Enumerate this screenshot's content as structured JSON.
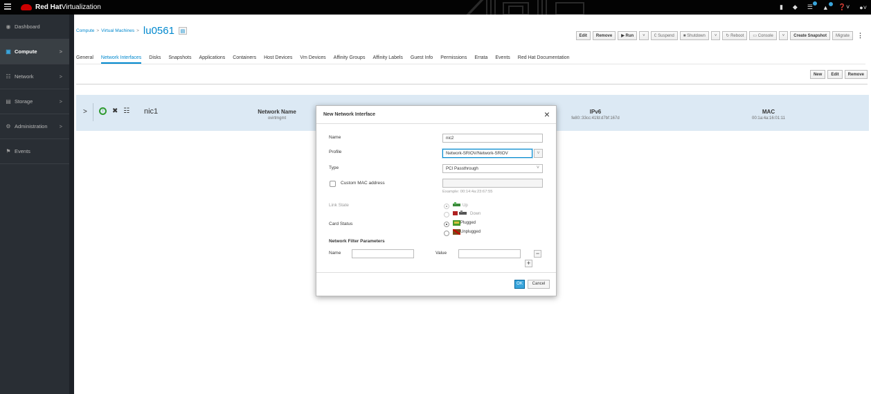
{
  "header": {
    "brand_red": "Red Hat",
    "brand_product": "Virtualization"
  },
  "sidebar": {
    "items": [
      {
        "label": "Dashboard",
        "icon": "dashboard-icon",
        "active": false
      },
      {
        "label": "Compute",
        "icon": "compute-icon",
        "active": true
      },
      {
        "label": "Network",
        "icon": "network-icon",
        "active": false
      },
      {
        "label": "Storage",
        "icon": "storage-icon",
        "active": false
      },
      {
        "label": "Administration",
        "icon": "gear-icon",
        "active": false
      },
      {
        "label": "Events",
        "icon": "flag-icon",
        "active": false
      }
    ]
  },
  "breadcrumb": {
    "compute": "Compute",
    "vms": "Virtual Machines",
    "sep": ">",
    "vm_name": "lu0561"
  },
  "actions": {
    "edit": "Edit",
    "remove": "Remove",
    "run": "▶ Run",
    "suspend": "Suspend",
    "shutdown": "Shutdown",
    "reboot": "Reboot",
    "console": "Console",
    "create_snapshot": "Create Snapshot",
    "migrate": "Migrate"
  },
  "tabs": [
    "General",
    "Network Interfaces",
    "Disks",
    "Snapshots",
    "Applications",
    "Containers",
    "Host Devices",
    "Vm Devices",
    "Affinity Groups",
    "Affinity Labels",
    "Guest Info",
    "Permissions",
    "Errata",
    "Events",
    "Red Hat Documentation"
  ],
  "sub_actions": {
    "new": "New",
    "edit": "Edit",
    "remove": "Remove"
  },
  "nic": {
    "name": "nic1",
    "network_name_header": "Network Name",
    "network_name_value": "ovirtmgmt",
    "ipv6_header": "IPv6",
    "ipv6_value": "fe80::33cc:41fd:d7bf:167d",
    "mac_header": "MAC",
    "mac_value": "00:1a:4a:16:01:11"
  },
  "dialog": {
    "title": "New Network Interface",
    "close": "×",
    "name_label": "Name",
    "name_value": "nic2",
    "profile_label": "Profile",
    "profile_value": "Network-SRIOV/Network-SRIOV",
    "type_label": "Type",
    "type_value": "PCI Passthrough",
    "custom_mac_label": "Custom MAC address",
    "mac_example": "Example: 00:14:4a:23:67:55",
    "link_state_label": "Link State",
    "link_up": "Up",
    "link_down": "Down",
    "card_status_label": "Card Status",
    "plugged": "Plugged",
    "unplugged": "Unplugged",
    "filter_params_label": "Network Filter Parameters",
    "filter_name_label": "Name",
    "filter_value_label": "Value",
    "minus": "−",
    "plus": "+",
    "ok": "OK",
    "cancel": "Cancel"
  },
  "colors": {
    "accent": "#0088ce",
    "topbar": "#030303",
    "sidebar": "#292e34",
    "row_highlight": "#dce9f4",
    "brand": "#cc0000"
  }
}
